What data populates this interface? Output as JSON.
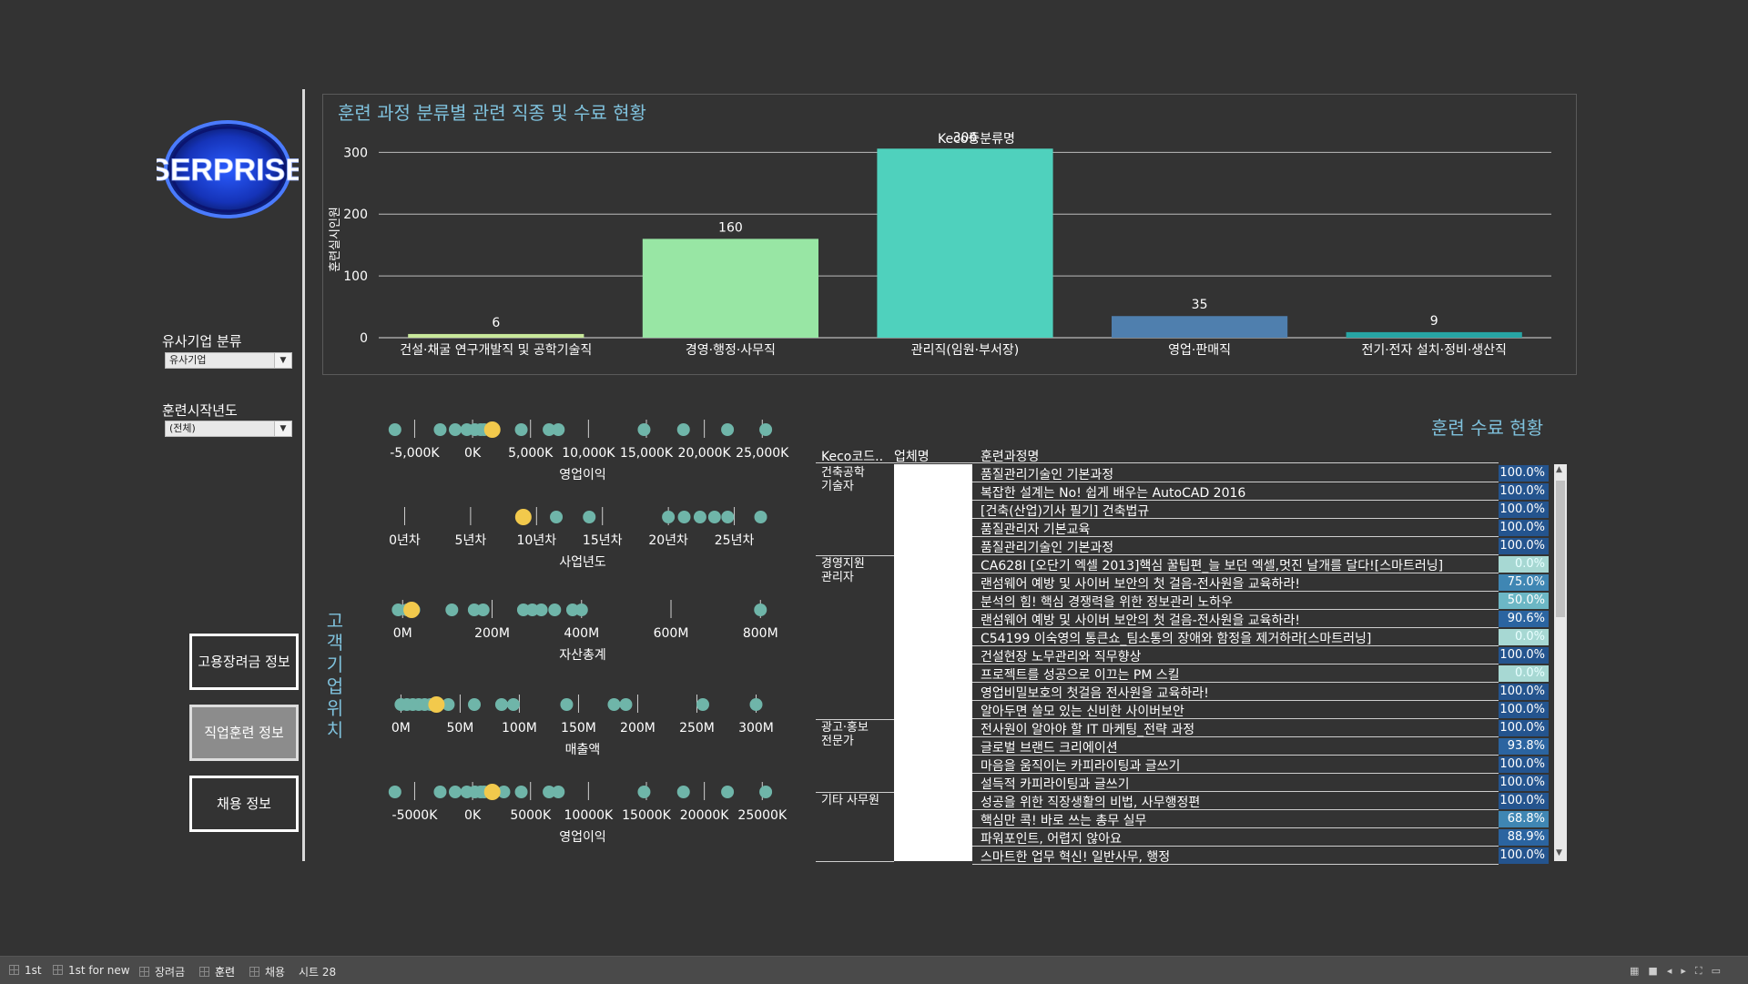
{
  "brand": {
    "logo_text": "SERPRISE"
  },
  "filters": {
    "company_category": {
      "label": "유사기업 분류",
      "value": "유사기업"
    },
    "start_year": {
      "label": "훈련시작년도",
      "value": "(전체)"
    }
  },
  "nav": {
    "btn1": "고용장려금 정보",
    "btn2": "직업훈련 정보",
    "btn3": "채용 정보"
  },
  "side_label": "고객기업위치",
  "bar_panel": {
    "title": "훈련 과정 분류별 관련 직종 및 수료 현황",
    "legend_title": "Keco중분류명"
  },
  "chart_data": [
    {
      "type": "bar",
      "title": "훈련 과정 분류별 관련 직종 및 수료 현황",
      "ylabel": "훈련실시인원",
      "ylim": [
        0,
        330
      ],
      "yticks": [
        0,
        100,
        200,
        300
      ],
      "categories": [
        "건설·채굴 연구개발직 및 공학기술직",
        "경영·행정·사무직",
        "관리직(임원·부서장)",
        "영업·판매직",
        "전기·전자 설치·정비·생산직"
      ],
      "values": [
        6,
        160,
        306,
        35,
        9
      ],
      "colors": [
        "#c8e89a",
        "#98e6a4",
        "#4fd1bd",
        "#4f7fae",
        "#27a5a4"
      ]
    },
    {
      "type": "scatter",
      "name": "operating_profit_1",
      "xlabel": "영업이익",
      "ticks": [
        -5000,
        0,
        5000,
        10000,
        15000,
        20000,
        25000
      ],
      "tick_labels": [
        "-5,000K",
        "0K",
        "5,000K",
        "10,000K",
        "15,000K",
        "20,000K",
        "25,000K"
      ],
      "xlim": [
        -7000,
        26000
      ],
      "points": [
        -6700,
        -2800,
        -1500,
        -500,
        200,
        700,
        1000,
        1500,
        4200,
        6600,
        7400,
        14800,
        18200,
        22000,
        25300
      ],
      "highlight": [
        1700
      ]
    },
    {
      "type": "scatter",
      "name": "business_years",
      "xlabel": "사업년도",
      "ticks": [
        0,
        5,
        10,
        15,
        20,
        25
      ],
      "tick_labels": [
        "0년차",
        "5년차",
        "10년차",
        "15년차",
        "20년차",
        "25년차"
      ],
      "xlim": [
        -1,
        28
      ],
      "points": [
        11.5,
        14,
        20,
        21.2,
        22.4,
        23.5,
        24.5,
        27
      ],
      "highlight": [
        9
      ]
    },
    {
      "type": "scatter",
      "name": "total_assets",
      "xlabel": "자산총계",
      "ticks": [
        0,
        200,
        400,
        600,
        800
      ],
      "tick_labels": [
        "0M",
        "200M",
        "400M",
        "600M",
        "800M"
      ],
      "xlim": [
        -25,
        830
      ],
      "points": [
        -10,
        10,
        25,
        110,
        160,
        180,
        270,
        290,
        310,
        340,
        380,
        400,
        800
      ],
      "highlight": [
        20
      ]
    },
    {
      "type": "scatter",
      "name": "revenue",
      "xlabel": "매출액",
      "ticks": [
        0,
        50,
        100,
        150,
        200,
        250,
        300
      ],
      "tick_labels": [
        "0M",
        "50M",
        "100M",
        "150M",
        "200M",
        "250M",
        "300M"
      ],
      "xlim": [
        -8,
        315
      ],
      "points": [
        0,
        5,
        10,
        15,
        20,
        25,
        40,
        62,
        85,
        95,
        140,
        180,
        190,
        255,
        300
      ],
      "highlight": [
        30
      ]
    },
    {
      "type": "scatter",
      "name": "operating_profit_2",
      "xlabel": "영업이익",
      "ticks": [
        -5000,
        0,
        5000,
        10000,
        15000,
        20000,
        25000
      ],
      "tick_labels": [
        "-5000K",
        "0K",
        "5000K",
        "10000K",
        "15000K",
        "20000K",
        "25000K"
      ],
      "xlim": [
        -7000,
        26000
      ],
      "points": [
        -6700,
        -2800,
        -1500,
        -500,
        200,
        700,
        1000,
        2700,
        4200,
        6600,
        7400,
        14800,
        18200,
        22000,
        25300
      ],
      "highlight": [
        1700
      ]
    }
  ],
  "table": {
    "title": "훈련 수료 현황",
    "headers": {
      "code": "Keco코드..",
      "company": "업체명",
      "course": "훈련과정명"
    },
    "categories": [
      {
        "label": "건축공학\n기술자",
        "row": 0
      },
      {
        "label": "경영지원\n관리자",
        "row": 5
      },
      {
        "label": "광고·홍보\n전문가",
        "row": 14
      },
      {
        "label": "기타 사무원",
        "row": 18
      }
    ],
    "rows": [
      {
        "course": "품질관리기술인 기본과정",
        "pct": "100.0%",
        "v": 100
      },
      {
        "course": "복잡한 설계는 No! 쉽게 배우는 AutoCAD 2016",
        "pct": "100.0%",
        "v": 100
      },
      {
        "course": "[건축(산업)기사 필기] 건축법규",
        "pct": "100.0%",
        "v": 100
      },
      {
        "course": "품질관리자 기본교육",
        "pct": "100.0%",
        "v": 100
      },
      {
        "course": "품질관리기술인 기본과정",
        "pct": "100.0%",
        "v": 100
      },
      {
        "course": "CA628I [오단기 엑셀 2013]핵심 꿀팁편_늘 보던 엑셀,멋진 날개를 달다![스마트러닝]",
        "pct": "0.0%",
        "v": 0
      },
      {
        "course": "랜섬웨어 예방 및 사이버 보안의 첫 걸음-전사원을 교육하라!",
        "pct": "75.0%",
        "v": 75
      },
      {
        "course": "분석의 힘! 핵심 경쟁력을 위한 정보관리 노하우",
        "pct": "50.0%",
        "v": 50
      },
      {
        "course": "랜섬웨어 예방 및 사이버 보안의 첫 걸음-전사원을 교육하라!",
        "pct": "90.6%",
        "v": 90.6
      },
      {
        "course": "C54199 이숙영의 통큰쇼_팀소통의 장애와 함정을 제거하라[스마트러닝]",
        "pct": "0.0%",
        "v": 0
      },
      {
        "course": "건설현장 노무관리와 직무향상",
        "pct": "100.0%",
        "v": 100
      },
      {
        "course": "프로젝트를 성공으로 이끄는 PM 스킬",
        "pct": "0.0%",
        "v": 0
      },
      {
        "course": "영업비밀보호의 첫걸음 전사원을 교육하라!",
        "pct": "100.0%",
        "v": 100
      },
      {
        "course": "알아두면 쓸모 있는 신비한 사이버보안",
        "pct": "100.0%",
        "v": 100
      },
      {
        "course": "전사원이 알아야 할 IT 마케팅_전략 과정",
        "pct": "100.0%",
        "v": 100
      },
      {
        "course": "글로벌 브랜드 크리에이션",
        "pct": "93.8%",
        "v": 93.8
      },
      {
        "course": "마음을 움직이는 카피라이팅과 글쓰기",
        "pct": "100.0%",
        "v": 100
      },
      {
        "course": "설득적 카피라이팅과 글쓰기",
        "pct": "100.0%",
        "v": 100
      },
      {
        "course": "성공을 위한 직장생활의 비법, 사무행정편",
        "pct": "100.0%",
        "v": 100
      },
      {
        "course": "핵심만 콕! 바로 쓰는 총무 실무",
        "pct": "68.8%",
        "v": 68.8
      },
      {
        "course": "파워포인트, 어렵지 않아요",
        "pct": "88.9%",
        "v": 88.9
      },
      {
        "course": "스마트한 업무 혁신! 일반사무, 행정",
        "pct": "100.0%",
        "v": 100
      }
    ]
  },
  "tabs": [
    {
      "label": "1st"
    },
    {
      "label": "1st for new"
    },
    {
      "label": "장려금"
    },
    {
      "label": "훈련",
      "active": true
    },
    {
      "label": "채용"
    },
    {
      "label": "시트 28"
    }
  ]
}
